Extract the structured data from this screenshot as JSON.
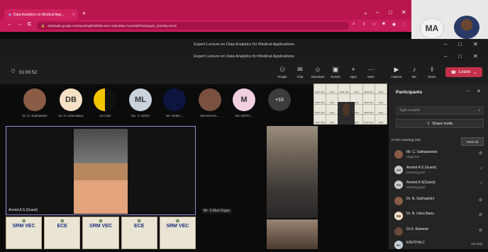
{
  "browser": {
    "tab_title": "Data Analytics on Medical App...",
    "tab_close": "×",
    "new_tab": "+",
    "url": "datastudio.google.com/reporting/fb16f056-a1ee-4c69-9b5a-7a1229b0f7b2/page/p_pr5sxl6yoc/edit",
    "window_controls": {
      "chevron": "⌄",
      "minimize": "–",
      "maximize": "□",
      "close": "✕"
    },
    "nav": {
      "back": "←",
      "forward": "→",
      "reload": "C"
    },
    "profile_initials": "MA"
  },
  "teams_window": {
    "title": "Expert Lecture on Data Analytics for Medical Applications",
    "controls": {
      "minimize": "–",
      "maximize": "□",
      "close": "✕"
    }
  },
  "meeting": {
    "timer": "01:00:52",
    "toolbar": [
      {
        "icon": "people-icon",
        "glyph": "⚇",
        "label": "People"
      },
      {
        "icon": "chat-icon",
        "glyph": "✉",
        "label": "Chat"
      },
      {
        "icon": "reactions-icon",
        "glyph": "☺",
        "label": "Reactions"
      },
      {
        "icon": "rooms-icon",
        "glyph": "▣",
        "label": "Rooms"
      },
      {
        "icon": "apps-icon",
        "glyph": "+",
        "label": "Apps"
      },
      {
        "icon": "more-icon",
        "glyph": "⋯",
        "label": "More"
      },
      {
        "icon": "camera-icon",
        "glyph": "▶",
        "label": "Camera"
      },
      {
        "icon": "mic-icon",
        "glyph": "♪",
        "label": "Mic"
      },
      {
        "icon": "share-icon",
        "glyph": "⇪",
        "label": "Share"
      }
    ],
    "leave_label": "Leave"
  },
  "roster": [
    {
      "initials": "",
      "name": "Dr. N. Subhashini",
      "bg": "#8a5b45"
    },
    {
      "initials": "DB",
      "name": "Dr. N. Usha Banu",
      "bg": "#f6e1c6"
    },
    {
      "initials": "",
      "name": "On hold",
      "bg": "#f3c400"
    },
    {
      "initials": "ML",
      "name": "Ms. V. USHA",
      "bg": "#c9d3dc"
    },
    {
      "initials": "",
      "name": "Mr. HEMA...",
      "bg": "#0e1440"
    },
    {
      "initials": "",
      "name": "MS.MAHAL...",
      "bg": "#7a5140"
    },
    {
      "initials": "M",
      "name": "Ms.ADITH...",
      "bg": "#f0cfe0"
    },
    {
      "initials": "+10",
      "name": "",
      "bg": "#3c3c3c"
    }
  ],
  "videos": {
    "main_label": "Arvind A S (Guest)",
    "secondary_label": "Mr. S Mari Rajan"
  },
  "banners": [
    "SRM VEC",
    "ECE",
    "SRM VEC",
    "ECE",
    "SRM VEC"
  ],
  "grid_cells": [
    "SRM VEC",
    "ECE",
    "SRM VEC",
    "ECE",
    "SRM VEC",
    "ECE"
  ],
  "participants_panel": {
    "title": "Participants",
    "search_placeholder": "Type a name",
    "share_invite": "Share invite",
    "in_meeting": "In this meeting (22)",
    "mute_all": "Mute all",
    "people": [
      {
        "initials": "",
        "name": "Mr. C. Sathiaseelan",
        "role": "Organizer",
        "bg": "#8a5b45",
        "fg": "#fff"
      },
      {
        "initials": "AS",
        "name": "Arwind A S (Guest)",
        "role": "Meeting guest",
        "bg": "#c9c9c9",
        "fg": "#333"
      },
      {
        "initials": "AS",
        "name": "Arwind A S(Guest)",
        "role": "Meeting guest",
        "bg": "#c9c9c9",
        "fg": "#333"
      },
      {
        "initials": "",
        "name": "Dr. N. Subhashini",
        "role": "",
        "bg": "#8a5b45",
        "fg": "#fff"
      },
      {
        "initials": "DB",
        "name": "Dr. N. Usha Banu",
        "role": "",
        "bg": "#f6e1c6",
        "fg": "#333"
      },
      {
        "initials": "",
        "name": "Dr.S. Ramesh",
        "role": "",
        "bg": "#6a4a3a",
        "fg": "#fff"
      },
      {
        "initials": "KC",
        "name": "KAVITHA C",
        "role": "",
        "bg": "#c9d3dc",
        "fg": "#333",
        "status": "On hold"
      }
    ]
  },
  "colors": {
    "chrome_accent": "#b9164f",
    "leave": "#c4314b",
    "panel": "#242424"
  }
}
